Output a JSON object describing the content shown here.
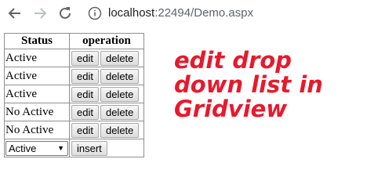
{
  "browser": {
    "url_host": "localhost",
    "url_rest": ":22494/Demo.aspx",
    "icons": {
      "back": "arrow-left-icon",
      "forward": "arrow-right-icon",
      "reload": "reload-icon",
      "info": "info-icon"
    }
  },
  "grid": {
    "headers": [
      "Status",
      "operation"
    ],
    "rows": [
      {
        "status": "Active",
        "edit": "edit",
        "delete": "delete"
      },
      {
        "status": "Active",
        "edit": "edit",
        "delete": "delete"
      },
      {
        "status": "Active",
        "edit": "edit",
        "delete": "delete"
      },
      {
        "status": "No Active",
        "edit": "edit",
        "delete": "delete"
      },
      {
        "status": "No Active",
        "edit": "edit",
        "delete": "delete"
      }
    ],
    "footer": {
      "selected": "Active",
      "insert_label": "insert"
    }
  },
  "overlay": {
    "lines": [
      "edit drop",
      "down list in",
      "Gridview"
    ],
    "color": "#e8192c"
  }
}
